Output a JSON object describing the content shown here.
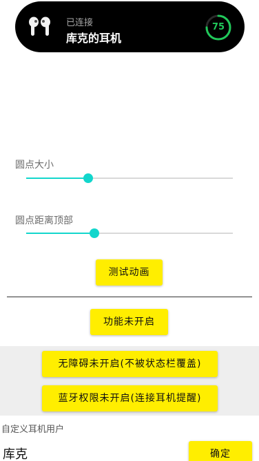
{
  "earphone_card": {
    "status": "已连接",
    "device_name": "库克的耳机",
    "battery_level": 75,
    "battery_text": "75",
    "battery_color": "#20c95a"
  },
  "settings": {
    "dot_size_label": "圆点大小",
    "dot_size_value": 0.3,
    "dot_top_label": "圆点距离顶部",
    "dot_top_value": 0.33,
    "slider_color": "#12d6cc"
  },
  "buttons": {
    "test_animation": "测试动画",
    "feature_status": "功能未开启",
    "accessibility": "无障碍未开启(不被状态栏覆盖)",
    "bluetooth": "蓝牙权限未开启(连接耳机提醒)",
    "confirm": "确定",
    "accent_color": "#ffee00"
  },
  "custom_user": {
    "label": "自定义耳机用户",
    "value": "库克"
  }
}
